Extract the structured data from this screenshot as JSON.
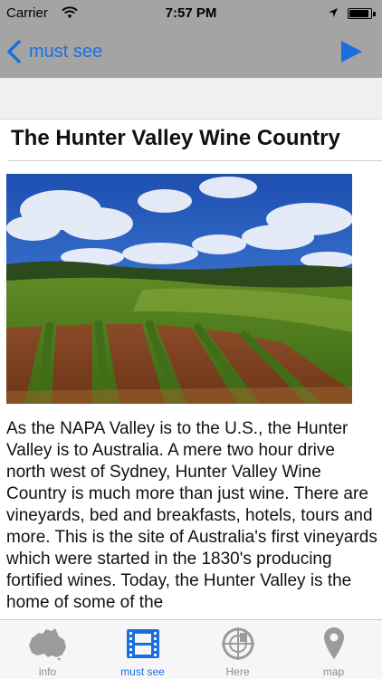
{
  "status_bar": {
    "carrier": "Carrier",
    "time": "7:57 PM",
    "battery_level": 0.95
  },
  "nav": {
    "back_label": "must see",
    "accent_color": "#1a6fe0"
  },
  "article": {
    "title": "The Hunter Valley Wine Country",
    "body": "As the NAPA Valley is to the U.S., the Hunter Valley is to Australia. A mere two hour drive north west of Sydney, Hunter Valley Wine Country is much more than just wine. There are vineyards, bed and breakfasts, hotels, tours and more. This is the site of Australia's first vineyards which were started in the 1830's producing fortified wines. Today, the Hunter Valley is the home of some of the"
  },
  "tabs": [
    {
      "label": "info",
      "icon": "australia-map-icon",
      "active": false
    },
    {
      "label": "must see",
      "icon": "film-strip-icon",
      "active": true
    },
    {
      "label": "Here",
      "icon": "crosshair-target-icon",
      "active": false
    },
    {
      "label": "map",
      "icon": "map-pin-icon",
      "active": false
    }
  ]
}
